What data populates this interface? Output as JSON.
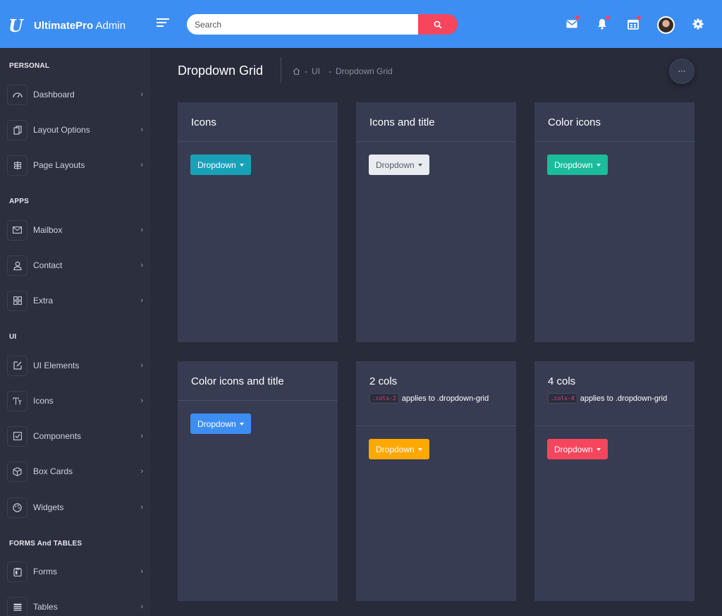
{
  "brand": {
    "logo": "U",
    "name_bold": "UltimatePro",
    "name_rest": " Admin"
  },
  "search": {
    "placeholder": "Search",
    "value": ""
  },
  "header_icons": [
    "mail-icon",
    "bell-icon",
    "calendar-icon",
    "gear-icon"
  ],
  "sidebar": {
    "sections": [
      {
        "title": "PERSONAL"
      },
      {
        "title": "APPS"
      },
      {
        "title": "UI"
      },
      {
        "title": "FORMS And TABLES"
      }
    ],
    "items": [
      {
        "label": "Dashboard",
        "icon": "speedometer-icon"
      },
      {
        "label": "Layout Options",
        "icon": "copy-icon"
      },
      {
        "label": "Page Layouts",
        "icon": "signpost-icon"
      },
      {
        "label": "Mailbox",
        "icon": "envelope-icon"
      },
      {
        "label": "Contact",
        "icon": "user-icon"
      },
      {
        "label": "Extra",
        "icon": "grid-icon"
      },
      {
        "label": "UI Elements",
        "icon": "edit-icon"
      },
      {
        "label": "Icons",
        "icon": "type-icon"
      },
      {
        "label": "Components",
        "icon": "check-square-icon"
      },
      {
        "label": "Box Cards",
        "icon": "box-icon"
      },
      {
        "label": "Widgets",
        "icon": "palette-icon"
      },
      {
        "label": "Forms",
        "icon": "clipboard-icon"
      },
      {
        "label": "Tables",
        "icon": "table-icon"
      }
    ],
    "chevron": "›"
  },
  "page": {
    "title": "Dropdown Grid",
    "breadcrumb": {
      "home_icon": "home-icon",
      "sep1": "-",
      "item1": "UI",
      "sep2": "-",
      "item2": "Dropdown Grid"
    },
    "more_label": "···"
  },
  "cards": [
    {
      "title": "Icons",
      "button": "Dropdown",
      "button_color": "#17a2b8"
    },
    {
      "title": "Icons and title",
      "button": "Dropdown",
      "button_color": "#e9ecef"
    },
    {
      "title": "Color icons",
      "button": "Dropdown",
      "button_color": "#1abc9c"
    },
    {
      "title": "Color icons and title",
      "button": "Dropdown",
      "button_color": "#3d8ef3"
    },
    {
      "title": "2 cols",
      "code": ".cols-2",
      "desc": "applies to .dropdown-grid",
      "button": "Dropdown",
      "button_color": "#ffa800"
    },
    {
      "title": "4 cols",
      "code": ".cols-4",
      "desc": "applies to .dropdown-grid",
      "button": "Dropdown",
      "button_color": "#f6465d"
    }
  ]
}
